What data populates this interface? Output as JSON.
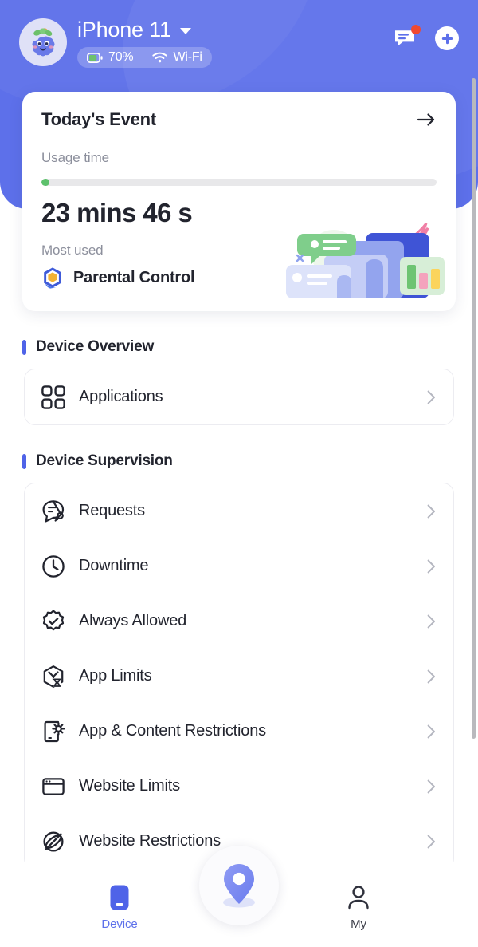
{
  "header": {
    "avatar": "grape-character-avatar",
    "device_name": "iPhone 11",
    "dropdown_icon": "caret-down-icon",
    "battery_text": "70%",
    "battery_icon": "battery-icon",
    "network_text": "Wi-Fi",
    "network_icon": "wifi-icon",
    "message_icon": "message-icon",
    "message_badge": true,
    "add_icon": "plus-icon",
    "bg_color": "#5d70ea"
  },
  "event_card": {
    "title": "Today's Event",
    "arrow_icon": "arrow-right-icon",
    "usage_label": "Usage time",
    "usage_value": "23 mins 46 s",
    "progress_percent": 2,
    "progress_color": "#5dc16c",
    "track_color": "#e8e8ea",
    "most_used_label": "Most used",
    "most_used_app": "Parental Control",
    "most_used_icon": "parental-control-app-icon",
    "illustration": "devices-illustration"
  },
  "sections": [
    {
      "title": "Device Overview",
      "accent": "#4f63e8",
      "items": [
        {
          "label": "Applications",
          "icon": "grid-apps-icon",
          "chevron": "chevron-right-icon"
        }
      ]
    },
    {
      "title": "Device Supervision",
      "accent": "#4f63e8",
      "items": [
        {
          "label": "Requests",
          "icon": "request-chat-icon",
          "chevron": "chevron-right-icon"
        },
        {
          "label": "Downtime",
          "icon": "clock-icon",
          "chevron": "chevron-right-icon"
        },
        {
          "label": "Always Allowed",
          "icon": "badge-check-icon",
          "chevron": "chevron-right-icon"
        },
        {
          "label": "App Limits",
          "icon": "hourglass-box-icon",
          "chevron": "chevron-right-icon"
        },
        {
          "label": "App & Content Restrictions",
          "icon": "phone-gear-icon",
          "chevron": "chevron-right-icon"
        },
        {
          "label": "Website Limits",
          "icon": "browser-window-icon",
          "chevron": "chevron-right-icon"
        },
        {
          "label": "Website Restrictions",
          "icon": "globe-slash-icon",
          "chevron": "chevron-right-icon"
        }
      ]
    }
  ],
  "fab": {
    "icon": "location-pin-icon",
    "color": "#7b8cf0"
  },
  "bottom_nav": {
    "items": [
      {
        "label": "Device",
        "icon": "device-phone-icon",
        "active": true,
        "color": "#5d70ea"
      },
      {
        "label": "My",
        "icon": "person-icon",
        "active": false,
        "color": "#3b3d48"
      }
    ]
  }
}
